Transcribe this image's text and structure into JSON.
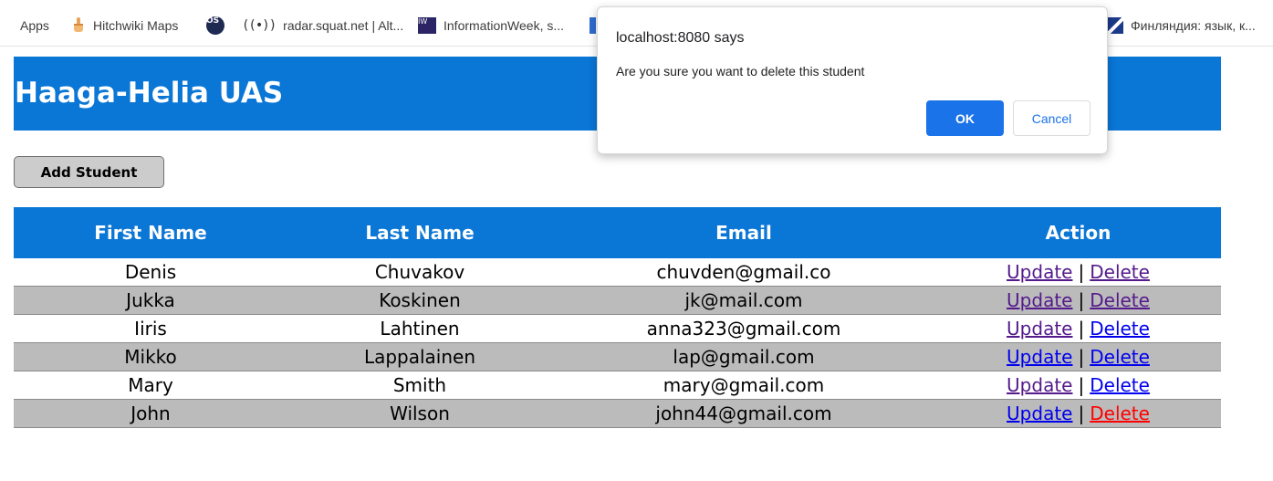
{
  "bookmarks": [
    {
      "icon": "apps-grid-icon",
      "label": "Apps"
    },
    {
      "icon": "thumb-icon",
      "label": "Hitchwiki Maps"
    },
    {
      "icon": "os-logo-icon",
      "label": ""
    },
    {
      "icon": "radio-waves-icon",
      "label": "radar.squat.net | Alt..."
    },
    {
      "icon": "informationweek-icon",
      "label": "InformationWeek, s..."
    },
    {
      "icon": "finland-flag-icon",
      "label": "Финляндия: язык, к..."
    }
  ],
  "header": {
    "title": "Haaga-Helia UAS"
  },
  "add_button": {
    "label": "Add Student"
  },
  "table": {
    "headers": [
      "First Name",
      "Last Name",
      "Email",
      "Action"
    ],
    "action_labels": {
      "update": "Update",
      "separator": "|",
      "delete": "Delete"
    },
    "rows": [
      {
        "first": "Denis",
        "last": "Chuvakov",
        "email": "chuvden@gmail.co"
      },
      {
        "first": "Jukka",
        "last": "Koskinen",
        "email": "jk@mail.com"
      },
      {
        "first": "Iiris",
        "last": "Lahtinen",
        "email": "anna323@gmail.com"
      },
      {
        "first": "Mikko",
        "last": "Lappalainen",
        "email": "lap@gmail.com"
      },
      {
        "first": "Mary",
        "last": "Smith",
        "email": "mary@gmail.com"
      },
      {
        "first": "John",
        "last": "Wilson",
        "email": "john44@gmail.com"
      }
    ]
  },
  "dialog": {
    "title": "localhost:8080 says",
    "message": "Are you sure you want to delete this student",
    "ok_label": "OK",
    "cancel_label": "Cancel"
  },
  "colors": {
    "header_blue": "#0a76d6",
    "alt_row": "#bbbbbb",
    "link": "#0000ee",
    "link_visited": "#551a8b",
    "link_active": "#ff0000",
    "dialog_ok": "#1a73e8"
  }
}
